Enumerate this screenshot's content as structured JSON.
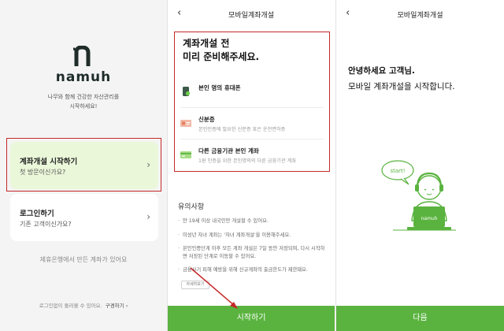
{
  "screen1": {
    "logo_text": "namuh",
    "tagline_line1": "나무와 함께 건강한 자산관리를",
    "tagline_line2": "시작하세요!",
    "card_open": {
      "title": "계좌개설 시작하기",
      "subtitle": "첫 방문이신가요?"
    },
    "card_login": {
      "title": "로그인하기",
      "subtitle": "기존 고객이신가요?"
    },
    "other_bank_link": "제휴은행에서 만든 계좌가 있어요",
    "help_text": "로그인없이 둘러볼 수 있어요.",
    "help_link": "구경하기 ›"
  },
  "screen2": {
    "title": "모바일계좌개설",
    "intro_line1": "계좌개설 전",
    "intro_line2": "미리 준비해주세요.",
    "requirements": [
      {
        "title": "본인 명의 휴대폰",
        "desc": "",
        "icon": "phone-icon"
      },
      {
        "title": "신분증",
        "desc": "본인인증에 필요한 신분증 혹은 운전면허증",
        "icon": "id-card-icon"
      },
      {
        "title": "다른 금융기관 본인 계좌",
        "desc": "1원 인증을 위한 본인명의의 다른 금융기관 계좌",
        "icon": "bank-card-icon"
      }
    ],
    "notice_heading": "유의사항",
    "notices": [
      "만 19세 이상 내국인만 개설할 수 있어요.",
      "미성년 자녀 계좌는 '자녀 계좌개설'을 이용해주세요.",
      "본인인증단계 이후 모든 계좌 개설은 7일 동안 저장되며, 다시 시작하면 저장된 단계로 이동할 수 있어요.",
      "금융사기 피해 예방을 위해 신규계좌의 출금한도가 제한돼요."
    ],
    "detail_button": "자세히보기",
    "start_button": "시작하기"
  },
  "screen3": {
    "title": "모바일계좌개설",
    "greeting_line1": "안녕하세요 고객님.",
    "greeting_line2": "모바일 계좌개설을 시작합니다.",
    "bubble_text": "start!",
    "laptop_text": "namuh",
    "next_button": "다음"
  },
  "colors": {
    "accent_green": "#5ab33f",
    "highlight_red": "#c62828",
    "card_green": "#eaf7d9"
  }
}
